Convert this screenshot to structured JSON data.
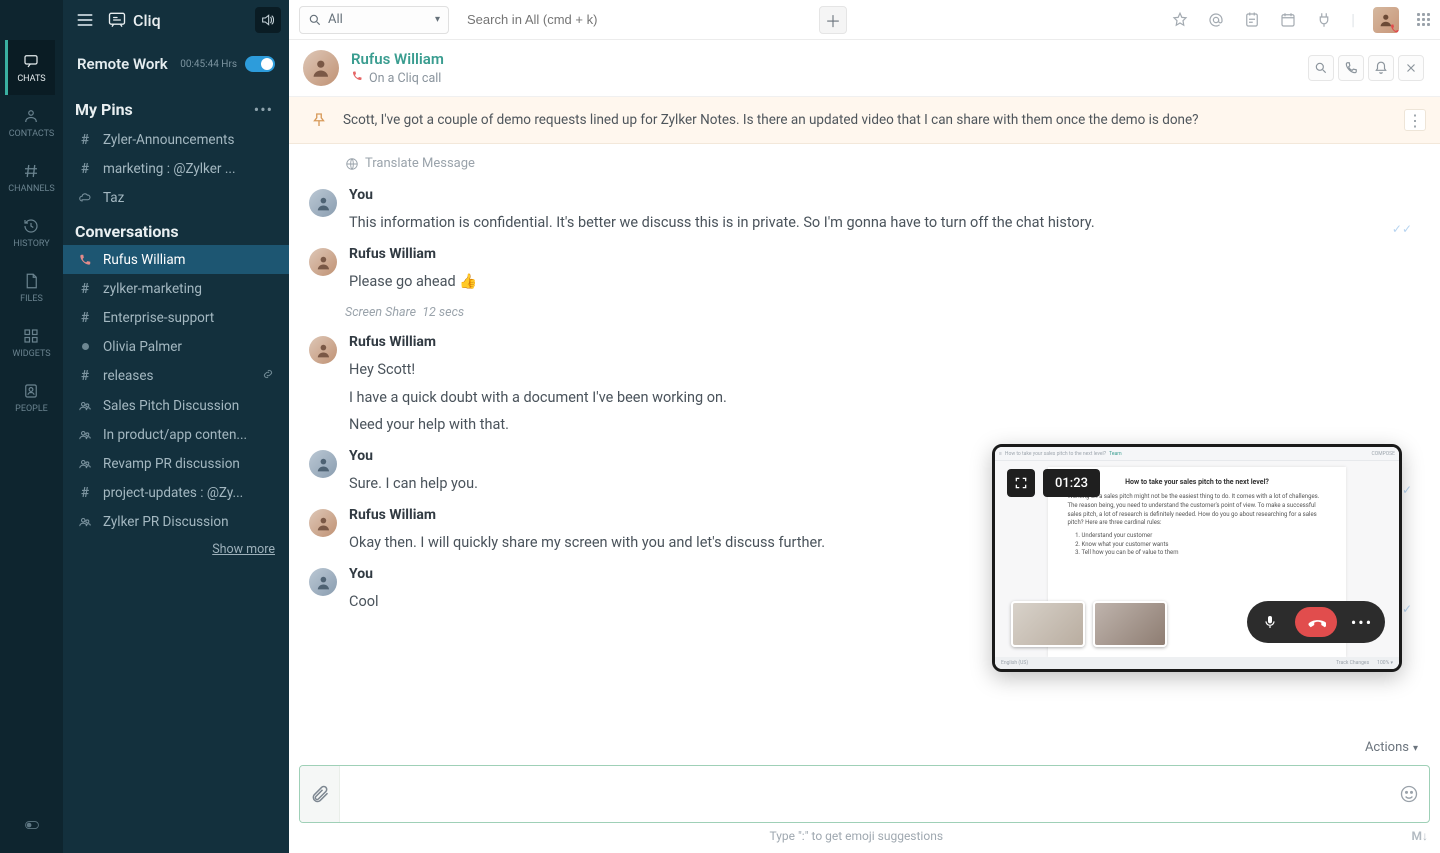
{
  "app": {
    "name": "Cliq"
  },
  "remote": {
    "label": "Remote Work",
    "time": "00:45:44 Hrs"
  },
  "mini_nav": [
    {
      "label": "CHATS",
      "icon": "chat-icon",
      "active": true
    },
    {
      "label": "CONTACTS",
      "icon": "contact-icon"
    },
    {
      "label": "CHANNELS",
      "icon": "hash-icon"
    },
    {
      "label": "HISTORY",
      "icon": "history-icon"
    },
    {
      "label": "FILES",
      "icon": "file-icon"
    },
    {
      "label": "WIDGETS",
      "icon": "widgets-icon"
    },
    {
      "label": "PEOPLE",
      "icon": "people-icon"
    }
  ],
  "pins": {
    "title": "My Pins",
    "items": [
      {
        "label": "Zyler-Announcements",
        "lead": "#"
      },
      {
        "label": "marketing : @Zylker ...",
        "lead": "#"
      },
      {
        "label": "Taz",
        "lead": "cloud"
      }
    ]
  },
  "conversations": {
    "title": "Conversations",
    "show_more": "Show more",
    "items": [
      {
        "label": "Rufus William",
        "lead": "call",
        "active": true
      },
      {
        "label": "zylker-marketing",
        "lead": "#"
      },
      {
        "label": "Enterprise-support",
        "lead": "#"
      },
      {
        "label": "Olivia Palmer",
        "lead": "dot"
      },
      {
        "label": "releases",
        "lead": "#",
        "tail": "link-icon"
      },
      {
        "label": "Sales Pitch Discussion",
        "lead": "group"
      },
      {
        "label": "In product/app conten...",
        "lead": "group"
      },
      {
        "label": "Revamp PR discussion",
        "lead": "group"
      },
      {
        "label": "project-updates : @Zy...",
        "lead": "#"
      },
      {
        "label": "Zylker PR Discussion",
        "lead": "group"
      }
    ]
  },
  "topbar": {
    "filter": "All",
    "search_placeholder": "Search in All (cmd + k)"
  },
  "chat": {
    "name": "Rufus William",
    "status": "On a Cliq call",
    "pinned": "Scott, I've got a couple of demo requests lined up for Zylker Notes. Is there an updated video that I can share with them once the demo is done?",
    "translate": "Translate Message",
    "screen_share_meta_a": "Screen Share",
    "screen_share_meta_b": "12 secs",
    "messages": [
      {
        "sender": "You",
        "avatar": "you",
        "lines": [
          "This information is confidential. It's better we discuss this is in private. So I'm gonna have to turn off the chat history."
        ],
        "read": true
      },
      {
        "sender": "Rufus William",
        "avatar": "rufus",
        "lines": [
          "Please go ahead  👍"
        ],
        "meta_after": true
      },
      {
        "sender": "Rufus William",
        "avatar": "rufus",
        "lines": [
          "Hey Scott!",
          "I have a quick doubt with a document I've been working on.",
          "Need your help with that."
        ]
      },
      {
        "sender": "You",
        "avatar": "you",
        "lines": [
          "Sure. I can help you."
        ],
        "read": true
      },
      {
        "sender": "Rufus William",
        "avatar": "rufus",
        "lines": [
          "Okay then. I will quickly share my screen with you and let's discuss further."
        ]
      },
      {
        "sender": "You",
        "avatar": "you",
        "lines": [
          "Cool"
        ],
        "read": true
      }
    ],
    "actions_label": "Actions"
  },
  "composer": {
    "emoji_hint": "Type \":\" to get emoji suggestions",
    "md": "M↓"
  },
  "call": {
    "timer": "01:23",
    "doc_title": "How to take your sales pitch to the next level?",
    "doc_body": "Working on a sales pitch might not be the easiest thing to do. It comes with a lot of challenges. The reason being, you need to understand the customer's point of view. To make a successful sales pitch, a lot of research is definitely needed. How do you go about researching for a sales pitch? Here are three cardinal rules:",
    "doc_list": [
      "Understand your customer",
      "Know what your customer wants",
      "Tell how you can be of value to them"
    ]
  }
}
